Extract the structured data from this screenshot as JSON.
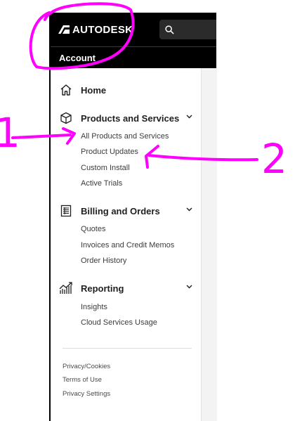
{
  "header": {
    "brand": "AUTODESK",
    "search_icon": "search-icon"
  },
  "account_bar": {
    "title": "Account"
  },
  "nav": {
    "home": {
      "label": "Home",
      "icon": "home-icon"
    },
    "products": {
      "label": "Products and Services",
      "icon": "box-icon",
      "items": [
        "All Products and Services",
        "Product Updates",
        "Custom Install",
        "Active Trials"
      ]
    },
    "billing": {
      "label": "Billing and Orders",
      "icon": "invoice-icon",
      "items": [
        "Quotes",
        "Invoices and Credit Memos",
        "Order History"
      ]
    },
    "reporting": {
      "label": "Reporting",
      "icon": "chart-icon",
      "items": [
        "Insights",
        "Cloud Services Usage"
      ]
    }
  },
  "footer": {
    "links": [
      "Privacy/Cookies",
      "Terms of Use",
      "Privacy Settings"
    ]
  },
  "annotations": {
    "label_1": "1",
    "label_2": "2",
    "color": "#ff00ff"
  },
  "colors": {
    "topbar": "#000000",
    "accent_annotation": "#ff00ff"
  }
}
